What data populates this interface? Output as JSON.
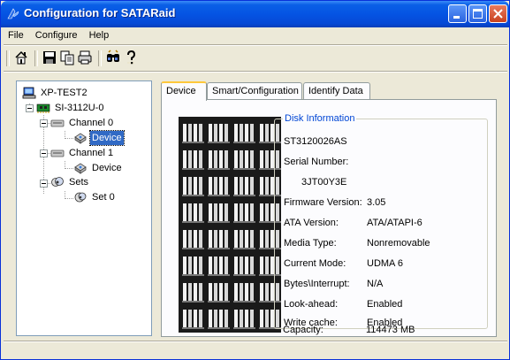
{
  "window": {
    "title": "Configuration for SATARaid",
    "controls": [
      "minimize",
      "maximize",
      "close"
    ]
  },
  "menu": {
    "items": [
      {
        "label": "File",
        "mnemonic": "F"
      },
      {
        "label": "Configure",
        "mnemonic": "C"
      },
      {
        "label": "Help",
        "mnemonic": "H"
      }
    ]
  },
  "toolbar": {
    "buttons": [
      "home-icon",
      "save-icon",
      "copy-icon",
      "print-icon",
      "find-icon",
      "help-icon"
    ]
  },
  "tree": {
    "root": "XP-TEST2",
    "controller": "SI-3112U-0",
    "channel0": "Channel 0",
    "channel0_device": "Device",
    "channel1": "Channel 1",
    "channel1_device": "Device",
    "sets": "Sets",
    "set0": "Set 0"
  },
  "tabs": [
    {
      "label": "Device",
      "active": true
    },
    {
      "label": "Smart/Configuration",
      "active": false
    },
    {
      "label": "Identify Data",
      "active": false
    }
  ],
  "disk_info": {
    "legend": "Disk Information",
    "model": "ST3120026AS",
    "serial_label": "Serial Number:",
    "serial_value": "3JT00Y3E",
    "fields": [
      {
        "label": "Firmware Version:",
        "value": "3.05"
      },
      {
        "label": "ATA Version:",
        "value": "ATA/ATAPI-6"
      },
      {
        "label": "Media Type:",
        "value": "Nonremovable"
      },
      {
        "label": "Current Mode:",
        "value": "UDMA 6"
      },
      {
        "label": "Bytes\\Interrupt:",
        "value": "N/A"
      },
      {
        "label": "Look-ahead:",
        "value": "Enabled"
      },
      {
        "label": "Write cache:",
        "value": "Enabled"
      },
      {
        "label": "Capacity:",
        "value": "114473 MB"
      }
    ]
  },
  "colors": {
    "titlebar": "#0554e3",
    "selection": "#316ac5",
    "legend": "#0046d5",
    "tab_highlight": "#ffc83c"
  }
}
